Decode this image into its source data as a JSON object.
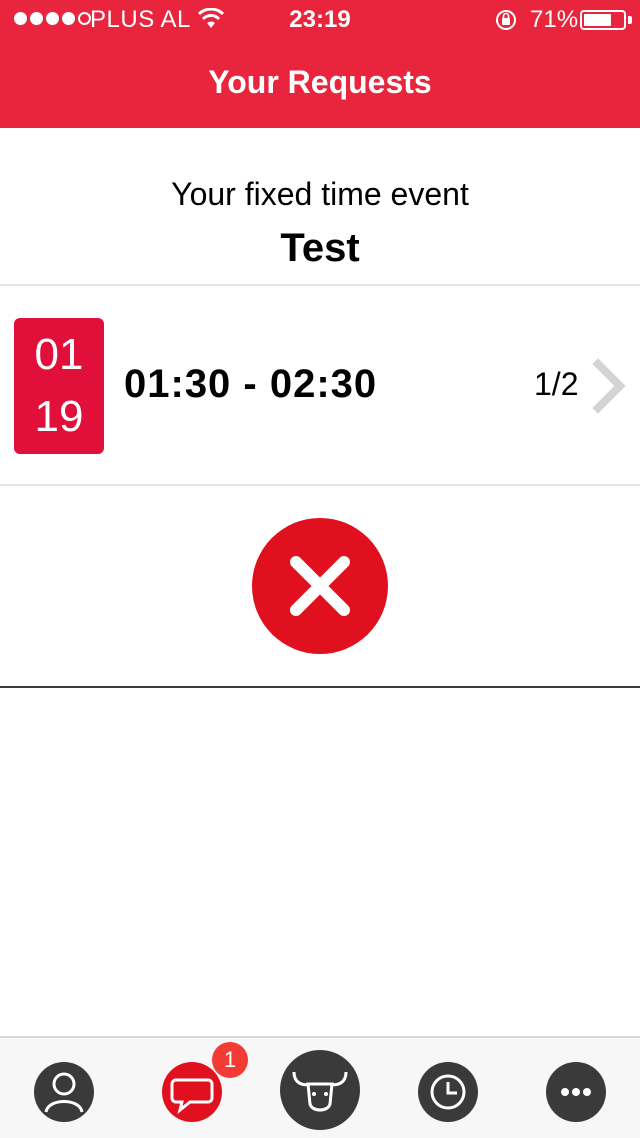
{
  "status_bar": {
    "carrier": "PLUS AL",
    "time": "23:19",
    "battery_percent": "71%",
    "battery_level": 0.71
  },
  "header": {
    "title": "Your Requests"
  },
  "event": {
    "subtitle": "Your fixed time event",
    "name": "Test"
  },
  "request": {
    "month": "01",
    "day": "19",
    "time_range": "01:30 - 02:30",
    "count": "1/2"
  },
  "tabbar": {
    "items": [
      {
        "icon": "profile-icon"
      },
      {
        "icon": "chat-bubble-icon",
        "badge": "1"
      },
      {
        "icon": "bull-logo-icon"
      },
      {
        "icon": "clock-icon"
      },
      {
        "icon": "more-icon"
      }
    ]
  },
  "colors": {
    "header_bg": "#e8253d",
    "accent_red": "#e0101f",
    "badge_red": "#f13b34",
    "tab_dark": "#3a3a3a"
  }
}
